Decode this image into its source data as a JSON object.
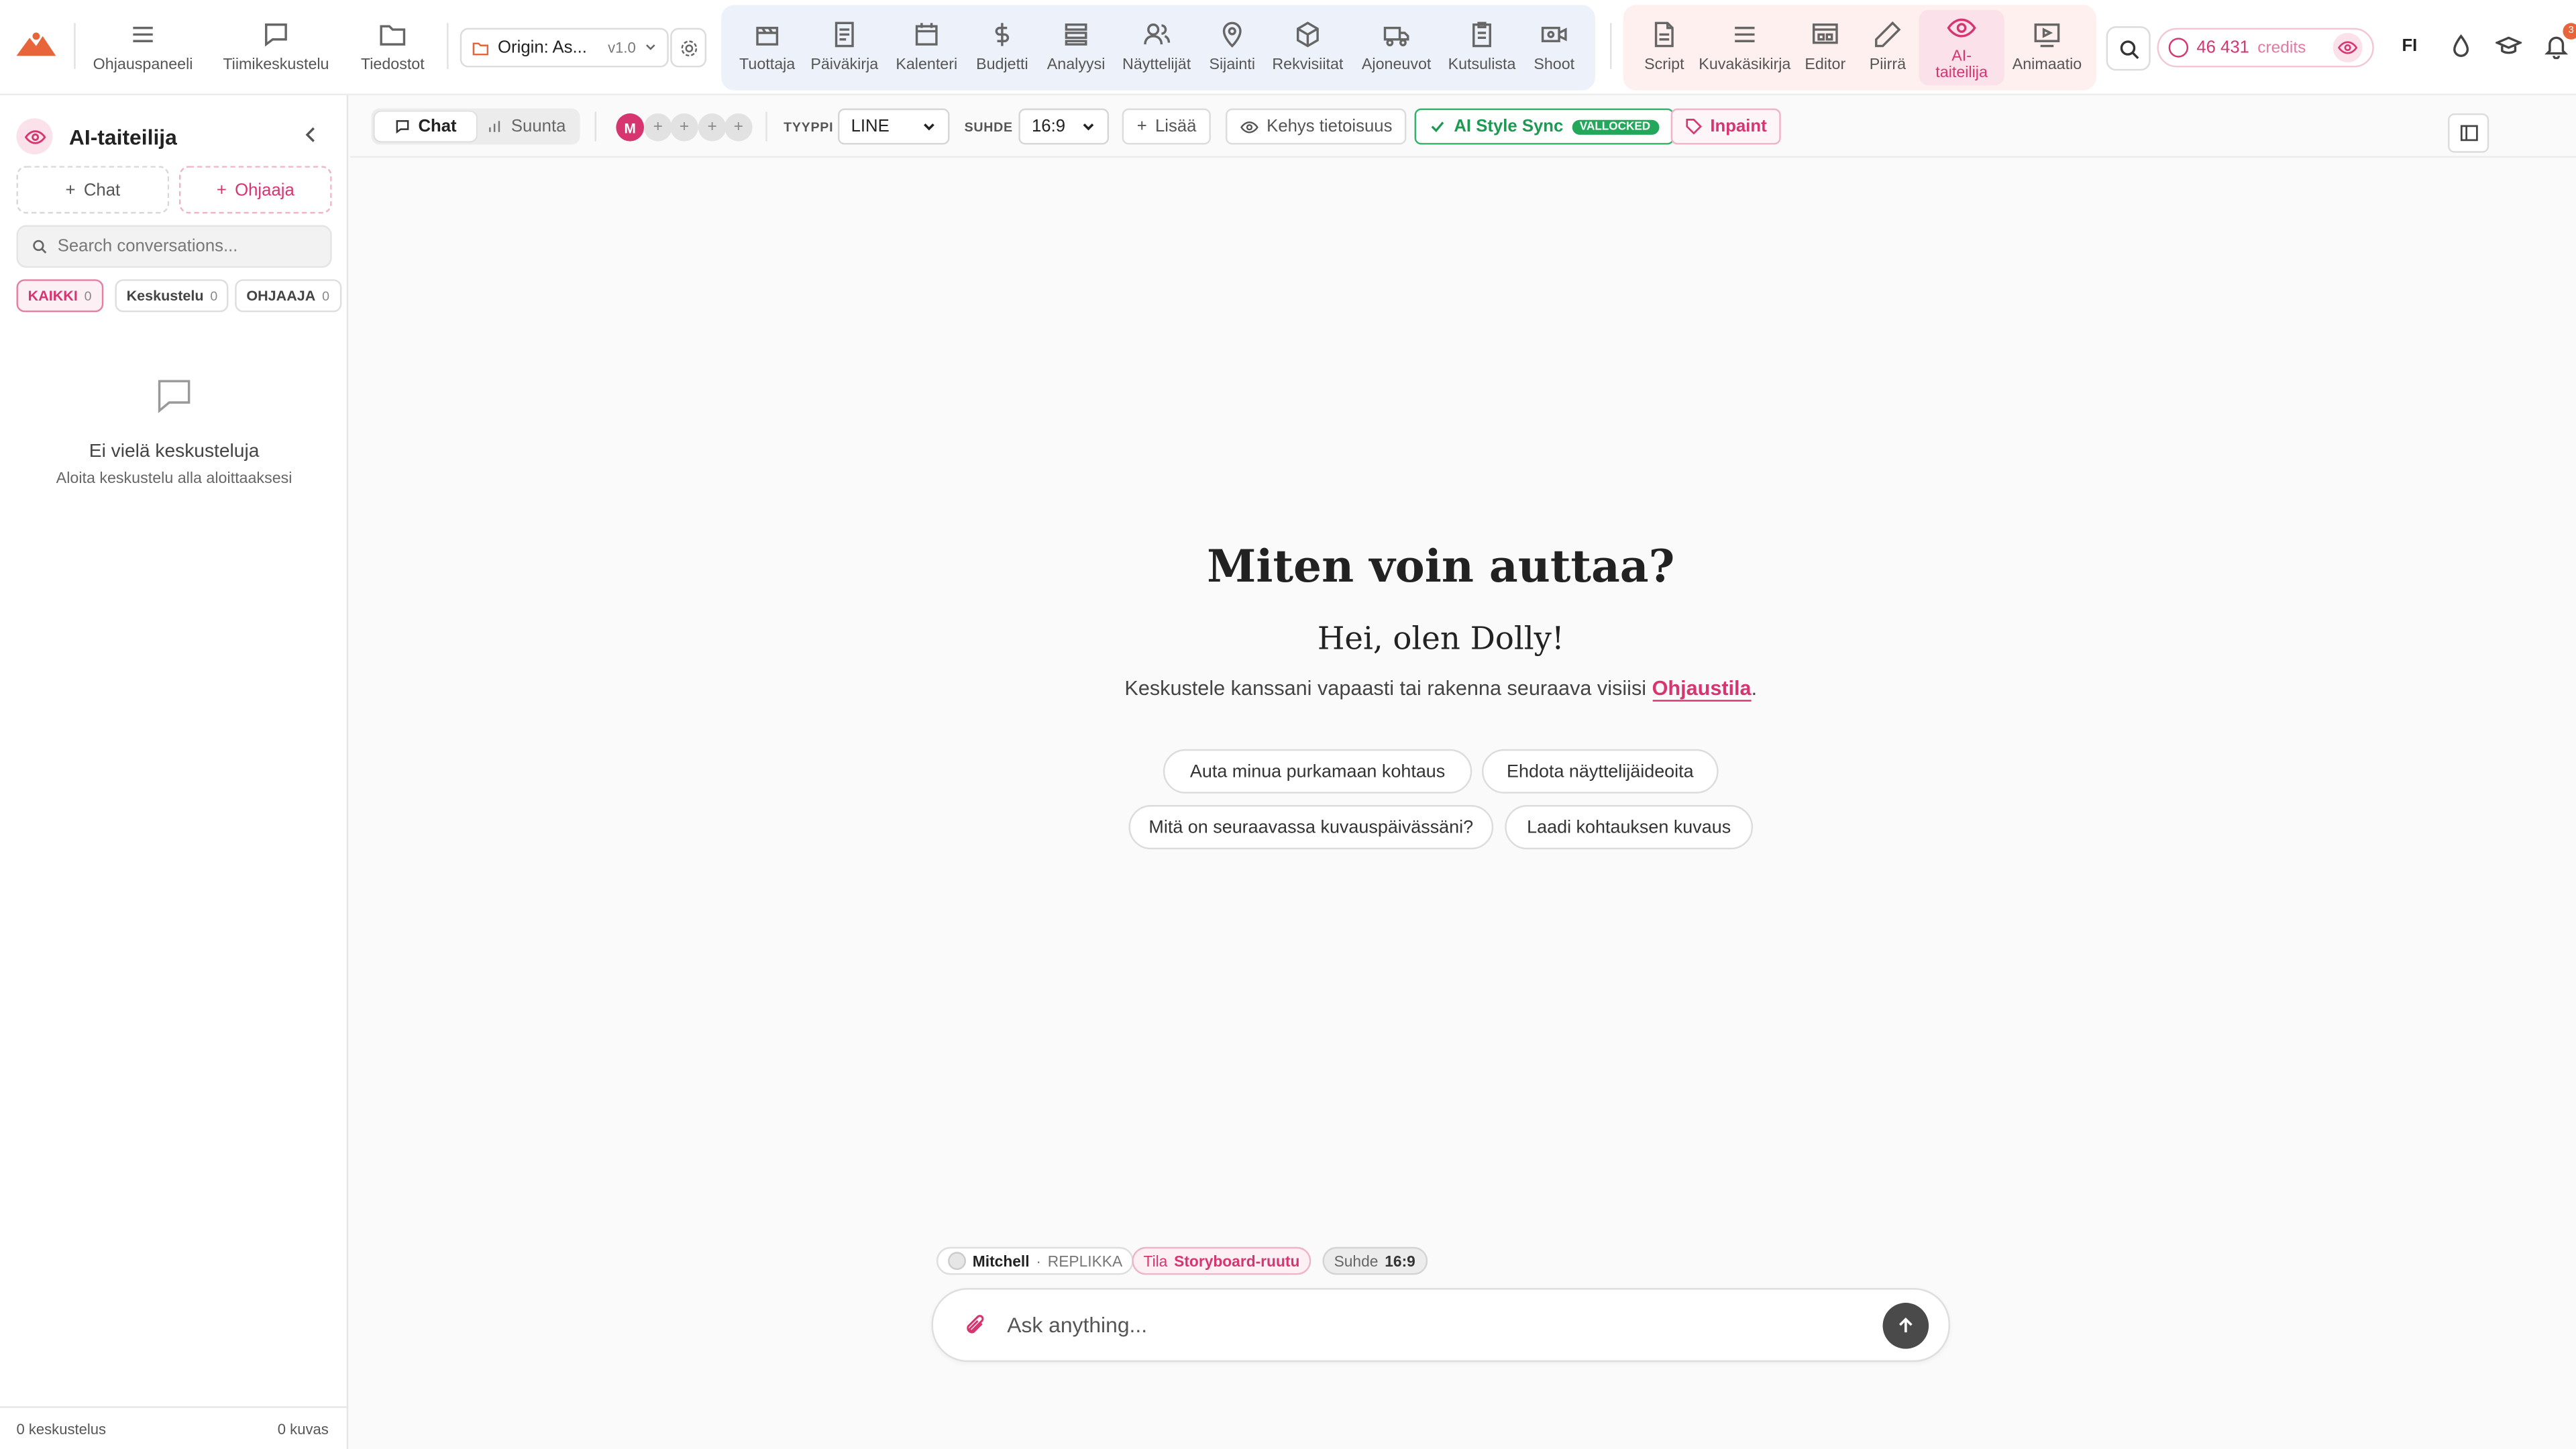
{
  "topbar": {
    "nav": [
      {
        "label": "Ohjauspaneeli",
        "icon": "menu-icon"
      },
      {
        "label": "Tiimikeskustelu",
        "icon": "chat-bubble-icon"
      },
      {
        "label": "Tiedostot",
        "icon": "folder-icon"
      }
    ],
    "project": {
      "name": "Origin: As...",
      "version": "v1.0"
    },
    "production_tools": [
      {
        "label": "Tuottaja",
        "icon": "clapperboard-icon"
      },
      {
        "label": "Päiväkirja",
        "icon": "notebook-icon"
      },
      {
        "label": "Kalenteri",
        "icon": "calendar-icon"
      },
      {
        "label": "Budjetti",
        "icon": "dollar-icon"
      },
      {
        "label": "Analyysi",
        "icon": "layers-icon"
      },
      {
        "label": "Näyttelijät",
        "icon": "users-icon"
      },
      {
        "label": "Sijainti",
        "icon": "map-pin-icon"
      },
      {
        "label": "Rekvisiitat",
        "icon": "box-icon"
      },
      {
        "label": "Ajoneuvot",
        "icon": "truck-icon"
      },
      {
        "label": "Kutsulista",
        "icon": "clipboard-icon"
      },
      {
        "label": "Shoot",
        "icon": "video-camera-icon"
      }
    ],
    "creative_tools": [
      {
        "label": "Script",
        "icon": "document-icon"
      },
      {
        "label": "Kuvakäsikirja",
        "icon": "list-icon"
      },
      {
        "label": "Editor",
        "icon": "editor-icon"
      },
      {
        "label": "Piirrä",
        "icon": "pencil-icon"
      },
      {
        "label": "AI-taiteilija",
        "icon": "eye-icon",
        "active": true
      },
      {
        "label": "Animaatio",
        "icon": "play-screen-icon"
      }
    ],
    "credits": {
      "amount": "46 431",
      "unit": "credits"
    },
    "language": "FI",
    "notification_count": "3"
  },
  "sidebar": {
    "title": "AI-taiteilija",
    "new_chat": "Chat",
    "new_director": "Ohjaaja",
    "search_placeholder": "Search conversations...",
    "filters": [
      {
        "label": "KAIKKI",
        "count": "0"
      },
      {
        "label": "Keskustelu",
        "count": "0"
      },
      {
        "label": "OHJAAJA",
        "count": "0"
      }
    ],
    "empty_title": "Ei vielä keskusteluja",
    "empty_subtitle": "Aloita keskustelu alla aloittaaksesi",
    "footer_conversations": "0 keskustelus",
    "footer_images": "0 kuvas"
  },
  "toolbar": {
    "mode_chat": "Chat",
    "mode_direction": "Suunta",
    "avatar_initial": "M",
    "type_label": "TYYPPI",
    "type_value": "LINE",
    "ratio_label": "SUHDE",
    "ratio_value": "16:9",
    "add_label": "Lisää",
    "frame_info_label": "Kehys tietoisuus",
    "style_sync_label": "AI Style Sync",
    "style_sync_badge": "VALLOCKED",
    "inpaint_label": "Inpaint"
  },
  "main": {
    "heading": "Miten voin auttaa?",
    "greeting": "Hei, olen Dolly!",
    "intro_before": "Keskustele kanssani vapaasti tai rakenna seuraava visiisi ",
    "intro_link": "Ohjaustila",
    "intro_after": ".",
    "suggestions": [
      "Auta minua purkamaan kohtaus",
      "Ehdota näyttelijäideoita",
      "Mitä on seuraavassa kuvauspäivässäni?",
      "Laadi kohtauksen kuvaus"
    ]
  },
  "composer": {
    "user_name": "Mitchell",
    "user_role": "REPLIKKA",
    "mode_label": "Tila",
    "mode_value": "Storyboard-ruutu",
    "ratio_label": "Suhde",
    "ratio_value": "16:9",
    "placeholder": "Ask anything..."
  },
  "colors": {
    "accent": "#d63570",
    "success": "#23a85b",
    "production_bg": "#edf2fa",
    "creative_bg": "#fdf0ee"
  }
}
